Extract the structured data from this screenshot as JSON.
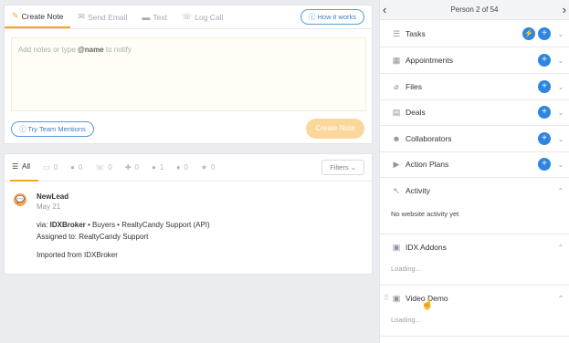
{
  "composer": {
    "tabs": [
      {
        "label": "Create Note",
        "icon": "pencil-icon",
        "glyph": "✎"
      },
      {
        "label": "Send Email",
        "icon": "email-icon",
        "glyph": "✉"
      },
      {
        "label": "Text",
        "icon": "chat-icon",
        "glyph": "▬"
      },
      {
        "label": "Log Call",
        "icon": "phone-icon",
        "glyph": "☏"
      }
    ],
    "how_it_works": "How it works",
    "notes_placeholder_pre": "Add notes or type ",
    "notes_placeholder_bold": "@name",
    "notes_placeholder_post": " to notify",
    "try_mentions": "Try Team Mentions",
    "create_button": "Create Note"
  },
  "feed": {
    "tabs": [
      {
        "label": "All",
        "icon": "list-icon",
        "glyph": "☰"
      },
      {
        "label": "0",
        "icon": "note-icon",
        "glyph": "▭"
      },
      {
        "label": "0",
        "icon": "chat-icon",
        "glyph": "●"
      },
      {
        "label": "0",
        "icon": "phone-icon",
        "glyph": "☏"
      },
      {
        "label": "0",
        "icon": "pin-icon",
        "glyph": "✚"
      },
      {
        "label": "1",
        "icon": "text-icon",
        "glyph": "●"
      },
      {
        "label": "0",
        "icon": "drop-icon",
        "glyph": "♦"
      },
      {
        "label": "0",
        "icon": "star-icon",
        "glyph": "★"
      }
    ],
    "filters": "Filters",
    "entry": {
      "name": "NewLead",
      "date": "May 21",
      "via_pre": "via: ",
      "via_source": "IDXBroker",
      "via_post": " • Buyers • RealtyCandy Support (API)",
      "assigned": "Assigned to: RealtyCandy Support",
      "imported": "Imported from IDXBroker"
    }
  },
  "panel": {
    "title": "Person 2 of 54",
    "rows": [
      {
        "label": "Tasks",
        "icon": "checklist-icon"
      },
      {
        "label": "Appointments",
        "icon": "calendar-icon"
      },
      {
        "label": "Files",
        "icon": "paperclip-icon"
      },
      {
        "label": "Deals",
        "icon": "tag-icon"
      },
      {
        "label": "Collaborators",
        "icon": "people-icon"
      },
      {
        "label": "Action Plans",
        "icon": "play-icon"
      }
    ],
    "activity": {
      "label": "Activity",
      "body": "No website activity yet"
    },
    "idx": {
      "label": "IDX Addons",
      "body": "Loading..."
    },
    "video": {
      "label": "Video Demo",
      "body": "Loading..."
    }
  },
  "colors": {
    "accent": "#f5a623",
    "blue": "#2f86e0"
  }
}
